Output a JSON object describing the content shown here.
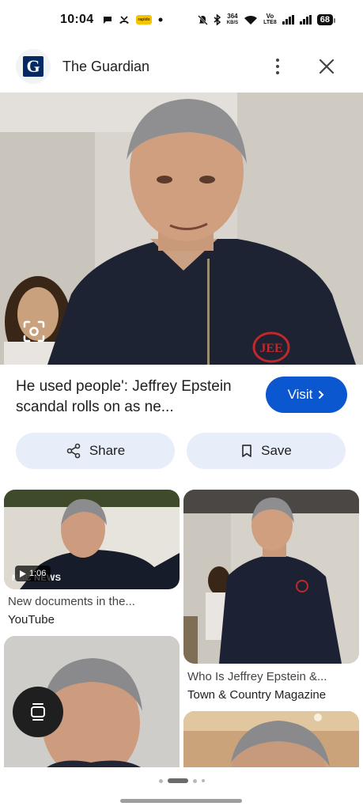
{
  "status_bar": {
    "time": "10:04",
    "net_speed_value": "364",
    "net_speed_unit": "KB/S",
    "volte_top": "Vo",
    "volte_bottom": "LTE8",
    "battery": "68",
    "app_badge": "rapido",
    "icons": [
      "chat-icon",
      "missed-call-icon",
      "app-badge",
      "dot",
      "mute-icon",
      "bluetooth-icon",
      "wifi-icon",
      "signal-icon",
      "signal-icon",
      "battery-icon"
    ]
  },
  "header": {
    "source_logo": "G",
    "source_name": "The Guardian",
    "more_icon": "more-vert-icon",
    "close_icon": "close-icon"
  },
  "hero": {
    "lens_icon": "lens-icon",
    "sweater_monogram": "JEE"
  },
  "result": {
    "title": "He used people': Jeffrey Epstein scandal rolls on as ne...",
    "visit_label": "Visit",
    "visit_icon": "chevron-right-icon",
    "share_label": "Share",
    "share_icon": "share-icon",
    "save_label": "Save",
    "save_icon": "bookmark-icon"
  },
  "related": [
    {
      "title": "New documents in the...",
      "source": "YouTube",
      "duration": "1:06",
      "watermark": "NBC NEWS",
      "play_icon": "play-icon"
    },
    {
      "title": "Who Is Jeffrey Epstein &...",
      "source": "Town & Country Magazine"
    }
  ],
  "floating_icon": "screen-capture-icon",
  "colors": {
    "accent": "#0b57d0",
    "chip_bg": "#e8eef9",
    "guardian_blue": "#052962"
  },
  "pager": {
    "pages": 4,
    "active": 1
  }
}
